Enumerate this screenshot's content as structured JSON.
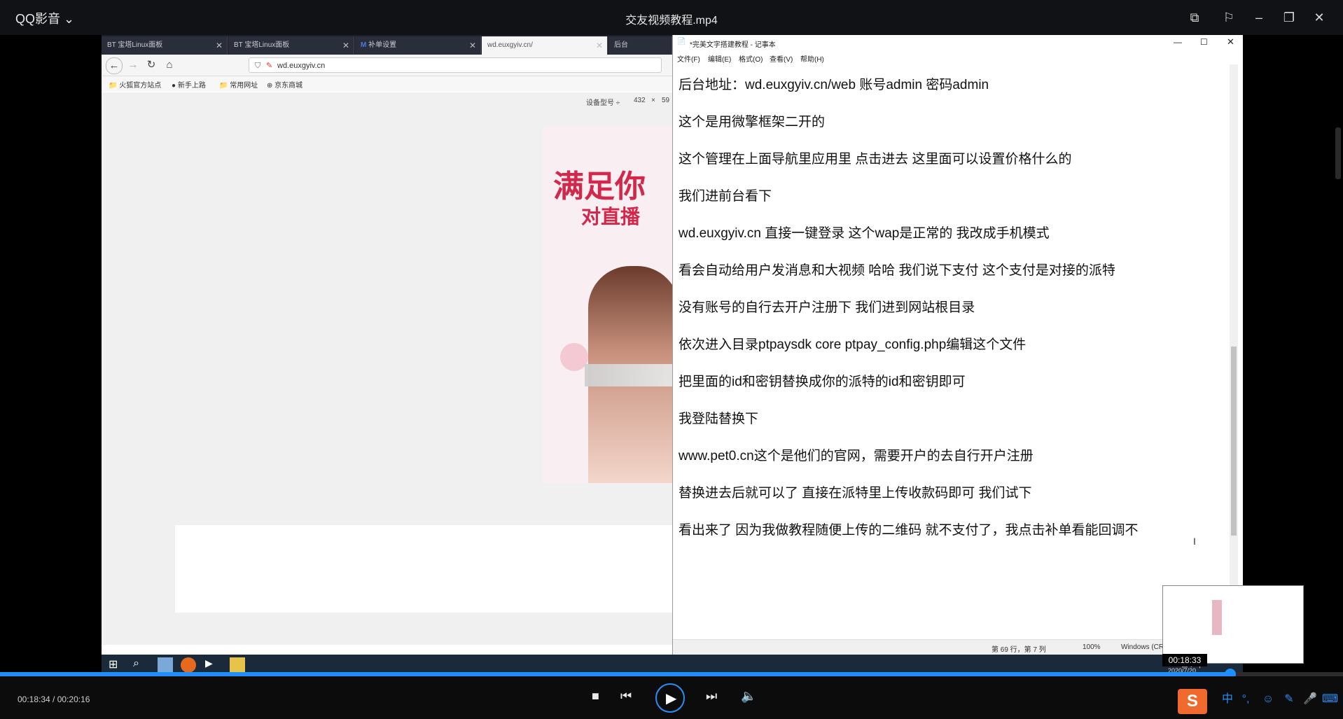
{
  "player": {
    "app_name": "QQ影音",
    "video_title": "交友视频教程.mp4",
    "time_current": "00:18:34",
    "time_total": "00:20:16",
    "timecode": "00:18:34 / 00:20:16",
    "progress_fraction": 0.916,
    "hover_time": "00:18:33",
    "colors": {
      "accent": "#1f8fff",
      "bg": "#000000"
    }
  },
  "browser": {
    "tabs": [
      {
        "label": "BT  宝塔Linux面板"
      },
      {
        "label": "BT  宝塔Linux面板"
      },
      {
        "label": "补单设置"
      },
      {
        "label": "wd.euxgyiv.cn/"
      },
      {
        "label": "后台"
      }
    ],
    "url": "wd.euxgyiv.cn",
    "bookmarks": [
      "火狐官方站点",
      "新手上路",
      "常用网址",
      "京东商城"
    ],
    "device_label": "设备型号 ÷",
    "device_width": "432",
    "device_times": "×",
    "device_height": "59"
  },
  "phone": {
    "headline": "满足你",
    "subline": "对直播"
  },
  "notepad": {
    "title": "*完美文字搭建教程 - 记事本",
    "menu": [
      "文件(F)",
      "编辑(E)",
      "格式(O)",
      "查看(V)",
      "帮助(H)"
    ],
    "lines": [
      "后台地址：wd.euxgyiv.cn/web 账号admin 密码admin",
      "这个是用微擎框架二开的",
      "这个管理在上面导航里应用里 点击进去 这里面可以设置价格什么的",
      "我们进前台看下",
      "wd.euxgyiv.cn  直接一键登录  这个wap是正常的 我改成手机模式",
      "看会自动给用户发消息和大视频 哈哈  我们说下支付  这个支付是对接的派特",
      "没有账号的自行去开户注册下 我们进到网站根目录",
      "依次进入目录ptpaysdk core  ptpay_config.php编辑这个文件",
      "把里面的id和密钥替换成你的派特的id和密钥即可",
      "我登陆替换下",
      "www.pet0.cn这个是他们的官网，需要开户的去自行开户注册",
      "替换进去后就可以了 直接在派特里上传收款码即可 我们试下",
      "看出来了  因为我做教程随便上传的二维码 就不支付了，我点击补单看能回调不"
    ],
    "status_position": "第 69 行，第 7 列",
    "status_zoom": "100%",
    "status_eol": "Windows (CRLF)"
  },
  "taskbar": {
    "date": "2020/7/20"
  },
  "tray": {
    "ime": "中",
    "punct": "°,"
  }
}
